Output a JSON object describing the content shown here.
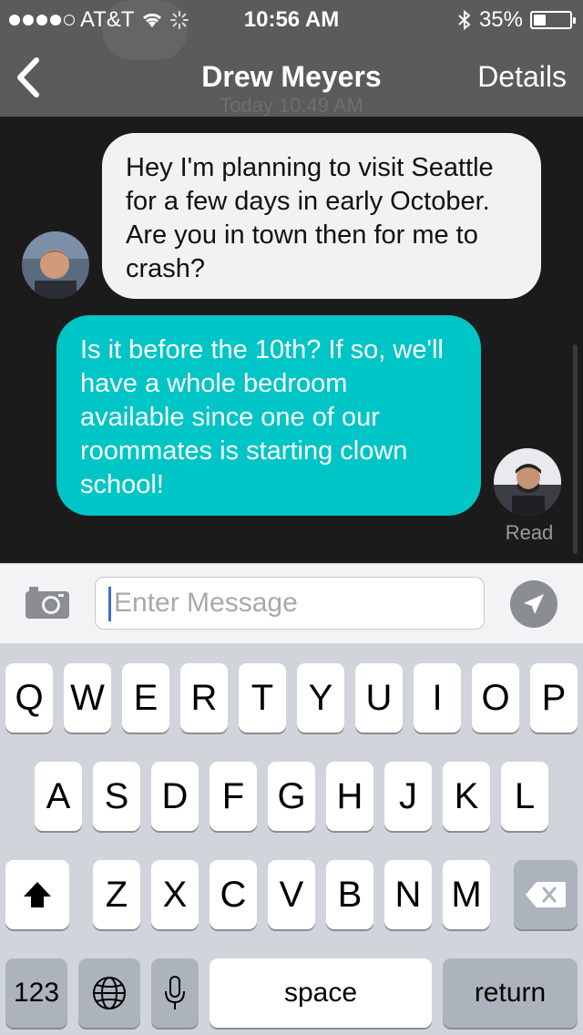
{
  "status_bar": {
    "carrier": "AT&T",
    "time": "10:56 AM",
    "battery": "35%",
    "battery_level": 0.35,
    "icons": [
      "signal-dots-icon",
      "wifi-icon",
      "activity-spinner-icon",
      "bluetooth-icon",
      "battery-icon"
    ]
  },
  "nav": {
    "back_icon": "chevron-left-icon",
    "title": "Drew Meyers",
    "details_label": "Details"
  },
  "conversation": {
    "timestamp": "Today 10:49 AM",
    "messages": [
      {
        "direction": "incoming",
        "text": "Hey I'm planning to visit Seattle for a few days in early October. Are you in town then for me to crash?"
      },
      {
        "direction": "outgoing",
        "text": "Is it before the 10th? If so, we'll have a whole bedroom available since one of our roommates is starting clown school!"
      }
    ],
    "read_receipt": "Read"
  },
  "composer": {
    "camera_icon": "camera-icon",
    "placeholder": "Enter Message",
    "value": "",
    "send_icon": "send-arrow-icon"
  },
  "keyboard": {
    "row1": [
      "Q",
      "W",
      "E",
      "R",
      "T",
      "Y",
      "U",
      "I",
      "O",
      "P"
    ],
    "row2": [
      "A",
      "S",
      "D",
      "F",
      "G",
      "H",
      "J",
      "K",
      "L"
    ],
    "row3": [
      "Z",
      "X",
      "C",
      "V",
      "B",
      "N",
      "M"
    ],
    "numbers_label": "123",
    "space_label": "space",
    "return_label": "return"
  },
  "colors": {
    "outgoing_bubble": "#00c5c7",
    "incoming_bubble": "#f2f2f2",
    "header": "#5b5b5b",
    "chat_background": "#1b1b1b",
    "keyboard_background": "#d1d5db"
  }
}
